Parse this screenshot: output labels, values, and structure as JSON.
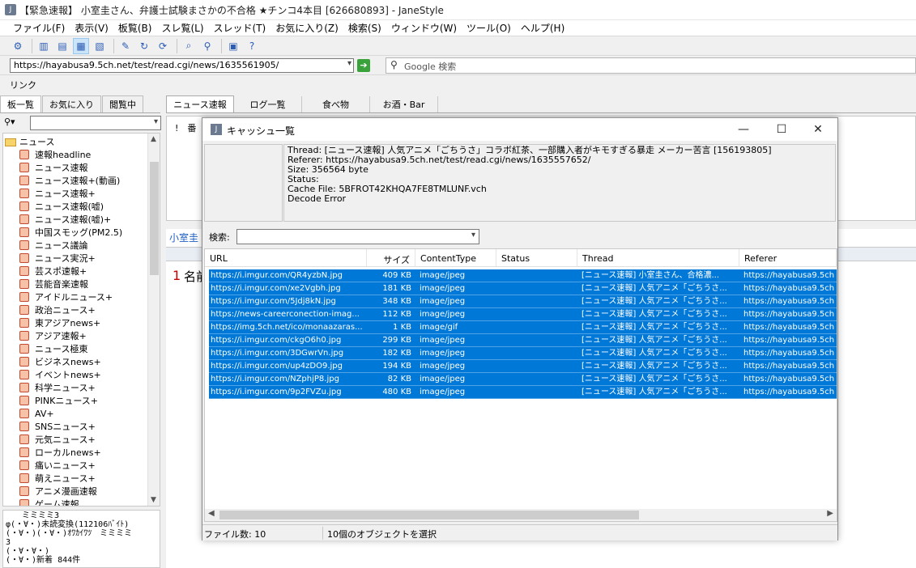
{
  "window": {
    "title": "【緊急速報】 小室圭さん、弁護士試験まさかの不合格 ★チンコ4本目 [626680893] - JaneStyle",
    "app_icon": "J"
  },
  "menu": [
    "ファイル(F)",
    "表示(V)",
    "板覧(B)",
    "スレ覧(L)",
    "スレッド(T)",
    "お気に入り(Z)",
    "検索(S)",
    "ウィンドウ(W)",
    "ツール(O)",
    "ヘルプ(H)"
  ],
  "toolbar_icons": [
    "settings-tool-icon",
    "layout-1-icon",
    "layout-2-icon",
    "layout-3-icon",
    "layout-4-icon",
    "write-icon",
    "refresh-icon",
    "refresh-all-icon",
    "find-icon",
    "search-icon",
    "image-icon",
    "help-icon"
  ],
  "address": {
    "url": "https://hayabusa9.5ch.net/test/read.cgi/news/1635561905/",
    "search_placeholder": "Google 検索"
  },
  "link_label": "リンク",
  "left_tabs": [
    "板一覧",
    "お気に入り",
    "閲覧中"
  ],
  "tree": {
    "root": "ニュース",
    "items": [
      "速報headline",
      "ニュース速報",
      "ニュース速報+(動画)",
      "ニュース速報+",
      "ニュース速報(嘘)",
      "ニュース速報(嘘)+",
      "中国スモッグ(PM2.5)",
      "ニュース議論",
      "ニュース実況+",
      "芸スポ速報+",
      "芸能音楽速報",
      "アイドルニュース+",
      "政治ニュース+",
      "東アジアnews+",
      "アジア速報+",
      "ニュース極東",
      "ビジネスnews+",
      "イベントnews+",
      "科学ニュース+",
      "PINKニュース+",
      "AV+",
      "SNSニュース+",
      "元気ニュース+",
      "ローカルnews+",
      "痛いニュース+",
      "萌えニュース+",
      "アニメ漫画速報",
      "ゲーム速報"
    ]
  },
  "log_lines": [
    "　　ミミミミ3",
    "φ(・∀・)未読変換(112106ﾊﾞｲﾄ)",
    "(・∀・)(・∀・)ｵﾜｶｲﾜﾂ　ミミミミ",
    "3",
    "(・∀・∀・)",
    "(・∀・)新着 844件"
  ],
  "right_tabs": [
    "ニュース速報",
    "ログ一覧",
    "食べ物",
    "お酒・Bar"
  ],
  "bg": {
    "list_header": "!　番",
    "thread_tab": "小室圭",
    "post_number": "1",
    "post_name": "名前"
  },
  "dialog": {
    "title": "キャッシュ一覧",
    "info": [
      "Thread: [ニュース速報] 人気アニメ「ごちうさ」コラボ紅茶、一部購入者がキモすぎる暴走 メーカー苦言 [156193805]",
      "Referer: https://hayabusa9.5ch.net/test/read.cgi/news/1635557652/",
      "Size: 356564 byte",
      "Status:",
      "Cache File: 5BFROT42KHQA7FE8TMLUNF.vch",
      "Decode Error"
    ],
    "search_label": "検索:",
    "columns": [
      "URL",
      "サイズ",
      "ContentType",
      "Status",
      "Thread",
      "Referer"
    ],
    "rows": [
      {
        "url": "https://i.imgur.com/QR4yzbN.jpg",
        "size": "409 KB",
        "type": "image/jpeg",
        "status": "",
        "thread": "[ニュース速報] 小室圭さん、合格濃...",
        "referer": "https://hayabusa9.5ch"
      },
      {
        "url": "https://i.imgur.com/xe2Vgbh.jpg",
        "size": "181 KB",
        "type": "image/jpeg",
        "status": "",
        "thread": "[ニュース速報] 人気アニメ「ごちうさ...",
        "referer": "https://hayabusa9.5ch"
      },
      {
        "url": "https://i.imgur.com/5Jdj8kN.jpg",
        "size": "348 KB",
        "type": "image/jpeg",
        "status": "",
        "thread": "[ニュース速報] 人気アニメ「ごちうさ...",
        "referer": "https://hayabusa9.5ch"
      },
      {
        "url": "https://news-careerconection-imag...",
        "size": "112 KB",
        "type": "image/jpeg",
        "status": "",
        "thread": "[ニュース速報] 人気アニメ「ごちうさ...",
        "referer": "https://hayabusa9.5ch"
      },
      {
        "url": "https://img.5ch.net/ico/monaazaras...",
        "size": "1 KB",
        "type": "image/gif",
        "status": "",
        "thread": "[ニュース速報] 人気アニメ「ごちうさ...",
        "referer": "https://hayabusa9.5ch"
      },
      {
        "url": "https://i.imgur.com/ckgO6h0.jpg",
        "size": "299 KB",
        "type": "image/jpeg",
        "status": "",
        "thread": "[ニュース速報] 人気アニメ「ごちうさ...",
        "referer": "https://hayabusa9.5ch"
      },
      {
        "url": "https://i.imgur.com/3DGwrVn.jpg",
        "size": "182 KB",
        "type": "image/jpeg",
        "status": "",
        "thread": "[ニュース速報] 人気アニメ「ごちうさ...",
        "referer": "https://hayabusa9.5ch"
      },
      {
        "url": "https://i.imgur.com/up4zDO9.jpg",
        "size": "194 KB",
        "type": "image/jpeg",
        "status": "",
        "thread": "[ニュース速報] 人気アニメ「ごちうさ...",
        "referer": "https://hayabusa9.5ch"
      },
      {
        "url": "https://i.imgur.com/NZphjP8.jpg",
        "size": "82 KB",
        "type": "image/jpeg",
        "status": "",
        "thread": "[ニュース速報] 人気アニメ「ごちうさ...",
        "referer": "https://hayabusa9.5ch"
      },
      {
        "url": "https://i.imgur.com/9p2FVZu.jpg",
        "size": "480 KB",
        "type": "image/jpeg",
        "status": "",
        "thread": "[ニュース速報] 人気アニメ「ごちうさ...",
        "referer": "https://hayabusa9.5ch"
      }
    ],
    "status_file_count": "ファイル数: 10",
    "status_selected": "10個のオブジェクトを選択"
  },
  "colors": {
    "selection": "#0078d7",
    "bg": "#f0f0f0"
  }
}
